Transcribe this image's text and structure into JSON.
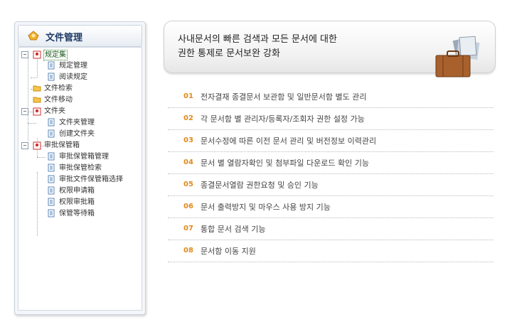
{
  "sidebar": {
    "title": "文件管理",
    "tree": [
      {
        "label": "规定集",
        "selected": true
      },
      {
        "label": "规定管理"
      },
      {
        "label": "阅读规定"
      },
      {
        "label": "文件检索"
      },
      {
        "label": "文件移动"
      },
      {
        "label": "文件夹"
      },
      {
        "label": "文件夹管理"
      },
      {
        "label": "创建文件夹"
      },
      {
        "label": "审批保管箱"
      },
      {
        "label": "审批保管箱管理"
      },
      {
        "label": "审批保管检索"
      },
      {
        "label": "审批文件保管箱选择"
      },
      {
        "label": "权限申请箱"
      },
      {
        "label": "权限审批箱"
      },
      {
        "label": "保管等待箱"
      }
    ],
    "toggle_symbol": "−"
  },
  "banner": {
    "line1": "사내문서의 빠른 검색과 모든 문서에 대한",
    "line2": "권한 통제로 문서보완 강화",
    "image_icon": "briefcase-with-documents-icon"
  },
  "features": [
    {
      "num": "01",
      "text": "전자결재 종결문서 보관함 및 일반문서함 별도 관리"
    },
    {
      "num": "02",
      "text": "각 문서함 별 관리자/등록자/조회자 권한 설정 가능"
    },
    {
      "num": "03",
      "text": "문서수정에 따른 이전 문서 관리 및 버전정보 이력관리"
    },
    {
      "num": "04",
      "text": "문서 별 열람자확인 및 첨부파일 다운로드 확인 기능"
    },
    {
      "num": "05",
      "text": "종결문서열람 권한요청 및 승인 기능"
    },
    {
      "num": "06",
      "text": "문서 출력방지 및 마우스 사용 방지 기능"
    },
    {
      "num": "07",
      "text": "통합 문서 검색 기능"
    },
    {
      "num": "08",
      "text": "문서함 이동 지원"
    }
  ],
  "colors": {
    "accent_number": "#e08a1e",
    "sidebar_title": "#1f3a66",
    "selection_border": "#2a7a2a"
  }
}
